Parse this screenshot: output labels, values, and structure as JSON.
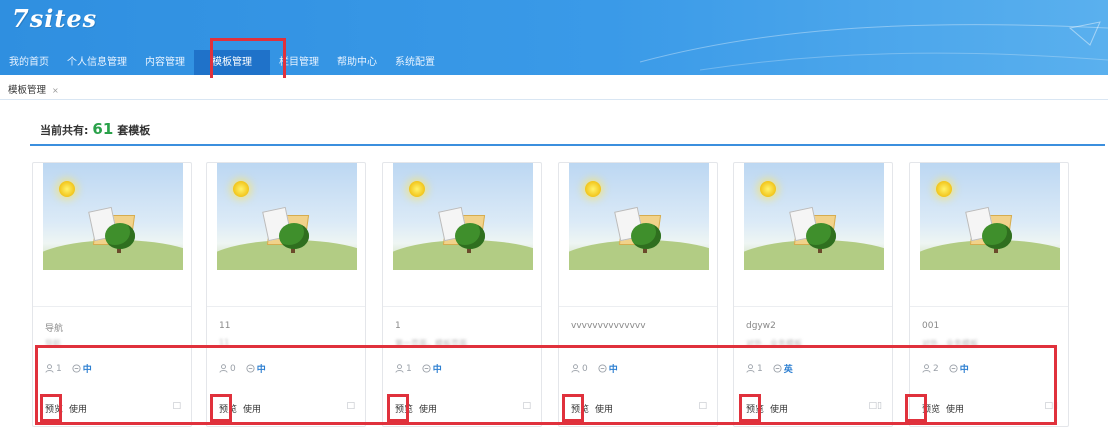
{
  "header": {
    "logo": "7sites",
    "nav": [
      "我的首页",
      "个人信息管理",
      "内容管理",
      "模板管理",
      "栏目管理",
      "帮助中心",
      "系统配置"
    ],
    "active_nav": "模板管理"
  },
  "tabs": [
    {
      "label": "模板管理",
      "close": "×"
    }
  ],
  "summary": {
    "prefix": "当前共有:",
    "count": "61",
    "suffix": "套模板"
  },
  "cards": [
    {
      "name": "导航",
      "desc": "导航",
      "users": "1",
      "lang": "中",
      "preview": "预览",
      "use": "使用",
      "right_icons": "□"
    },
    {
      "name": "11",
      "desc": "11",
      "users": "0",
      "lang": "中",
      "preview": "预览",
      "use": "使用",
      "right_icons": "□"
    },
    {
      "name": "1",
      "desc": "第一页面，模板页面",
      "users": "1",
      "lang": "中",
      "preview": "预览",
      "use": "使用",
      "right_icons": "□"
    },
    {
      "name": "vvvvvvvvvvvvvv",
      "desc": "",
      "users": "0",
      "lang": "中",
      "preview": "预览",
      "use": "使用",
      "right_icons": "□"
    },
    {
      "name": "dgyw2",
      "desc": "对外…业务模板",
      "users": "1",
      "lang": "英",
      "preview": "预览",
      "use": "使用",
      "right_icons": "□▯"
    },
    {
      "name": "001",
      "desc": "对外…业务模板",
      "users": "2",
      "lang": "中",
      "preview": "预览",
      "use": "使用",
      "right_icons": "□▯"
    }
  ],
  "colors": {
    "header_blue": "#3a9ae8",
    "active_tab": "#1f72c9",
    "count_green": "#2aa14a",
    "highlight_red": "#e0313c",
    "lang_blue": "#2d7fd1"
  }
}
